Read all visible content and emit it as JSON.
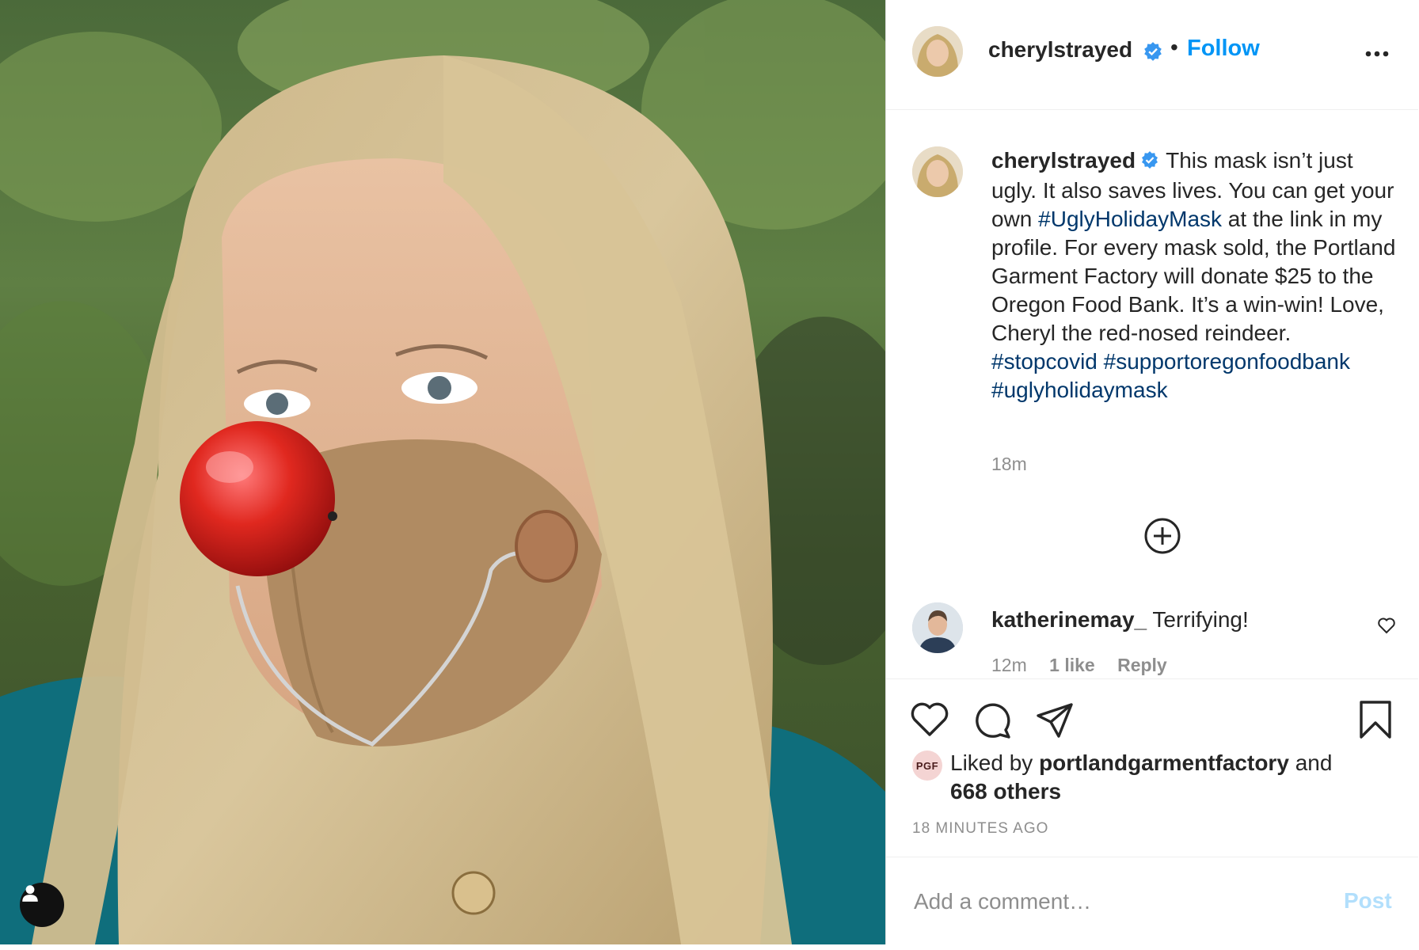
{
  "post": {
    "author": {
      "username": "cherylstrayed",
      "verified": true,
      "follow_label": "Follow",
      "separator": "•"
    },
    "caption": {
      "username": "cherylstrayed",
      "text_part1": "This mask isn’t just ugly. It also saves lives. You can get your own ",
      "hashtag_main": "#UglyHolidayMask",
      "text_part2": " at the link in my profile. For every mask sold, the Portland Garment Factory will donate $25 to the Oregon Food Bank. It’s a win-win! Love, Cheryl the red-nosed reindeer.",
      "hashtags_line1": "#stopcovid #supportoregonfoodbank",
      "hashtags_line2": "#uglyholidaymask",
      "time": "18m"
    },
    "comments": [
      {
        "username": "katherinemay_",
        "text": "Terrifying!",
        "time": "12m",
        "likes": "1 like",
        "reply": "Reply"
      }
    ],
    "likes": {
      "prefix": "Liked by",
      "user": "portlandgarmentfactory",
      "conj": "and",
      "others": "668 others",
      "avatar_text": "PGF"
    },
    "timestamp": "18 MINUTES AGO",
    "add_comment": {
      "placeholder": "Add a comment…",
      "post_label": "Post"
    },
    "icons": {
      "more": "more-options-icon",
      "verified": "verified-badge-icon",
      "load_more": "plus-circle-icon",
      "like": "heart-icon",
      "comment": "comment-bubble-icon",
      "share": "paper-plane-icon",
      "save": "bookmark-icon",
      "user_tag": "user-tag-icon"
    },
    "colors": {
      "accent": "#0095f6",
      "hashtag": "#00376b",
      "muted": "#8e8e8e",
      "post_disabled": "#b2dffc",
      "nose": "#d61f1f",
      "mask": "#b08b62"
    }
  }
}
